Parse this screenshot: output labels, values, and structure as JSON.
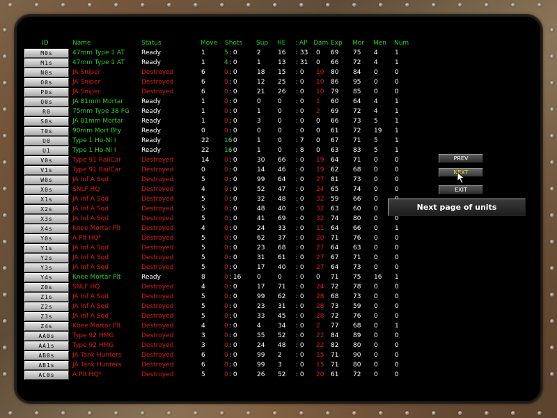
{
  "headers": {
    "id": "ID",
    "name": "Name",
    "status": "Status",
    "move": "Move",
    "shots": "Shots",
    "sup": "Sup",
    "he": "HE",
    "ap": ": AP",
    "dam": "Dam",
    "exp": "Exp",
    "mor": "Mor",
    "men": "Men",
    "num": "Num"
  },
  "units": [
    {
      "id": "M0s",
      "name": "47mm Type 1 AT",
      "status": "Ready",
      "move": "1",
      "shots_a": "5",
      "shots_b": ": 0",
      "sup": "2",
      "he": "16",
      "ap": ": 33",
      "dam": "0",
      "exp": "69",
      "mor": "75",
      "men": "4",
      "num": "1"
    },
    {
      "id": "M1s",
      "name": "47mm Type 1 AT",
      "status": "Ready",
      "move": "1",
      "shots_a": "4",
      "shots_b": ": 0",
      "sup": "1",
      "he": "13",
      "ap": ": 31",
      "dam": "0",
      "exp": "66",
      "mor": "72",
      "men": "4",
      "num": "1"
    },
    {
      "id": "N0s",
      "name": "JA Sniper",
      "status": "Destroyed",
      "move": "6",
      "shots_a": "0",
      "shots_b": ": 0",
      "sup": "18",
      "he": "15",
      "ap": ": 0",
      "dam": "10",
      "exp": "80",
      "mor": "84",
      "men": "0",
      "num": "0"
    },
    {
      "id": "O0s",
      "name": "JA Sniper",
      "status": "Destroyed",
      "move": "6",
      "shots_a": "0",
      "shots_b": ": 0",
      "sup": "12",
      "he": "25",
      "ap": ": 0",
      "dam": "10",
      "exp": "86",
      "mor": "95",
      "men": "0",
      "num": "0"
    },
    {
      "id": "P0s",
      "name": "JA Sniper",
      "status": "Destroyed",
      "move": "6",
      "shots_a": "0",
      "shots_b": ": 0",
      "sup": "21",
      "he": "26",
      "ap": ": 0",
      "dam": "10",
      "exp": "79",
      "mor": "85",
      "men": "0",
      "num": "0"
    },
    {
      "id": "Q0s",
      "name": "JA 81mm Mortar",
      "status": "Ready",
      "move": "1",
      "shots_a": "0",
      "shots_b": ": 0",
      "sup": "0",
      "he": "0",
      "ap": ": 0",
      "dam": "1",
      "exp": "60",
      "mor": "64",
      "men": "4",
      "num": "1"
    },
    {
      "id": "R0",
      "name": "75mm Type 38 FG",
      "status": "Ready",
      "move": "1",
      "shots_a": "0",
      "shots_b": ": 0",
      "sup": "1",
      "he": "0",
      "ap": ": 0",
      "dam": "2",
      "exp": "69",
      "mor": "72",
      "men": "4",
      "num": "1"
    },
    {
      "id": "S0s",
      "name": "JA 81mm Mortar",
      "status": "Ready",
      "move": "1",
      "shots_a": "0",
      "shots_b": ": 0",
      "sup": "3",
      "he": "0",
      "ap": ": 0",
      "dam": "0",
      "exp": "66",
      "mor": "73",
      "men": "5",
      "num": "1"
    },
    {
      "id": "T0s",
      "name": "90mm Mort Bty",
      "status": "Ready",
      "move": "0",
      "shots_a": "0",
      "shots_b": ": 0",
      "sup": "0",
      "he": "0",
      "ap": ": 0",
      "dam": "0",
      "exp": "61",
      "mor": "72",
      "men": "19",
      "num": "1"
    },
    {
      "id": "U0",
      "name": "Type 1 Ho-Ni I",
      "status": "Ready",
      "move": "22",
      "shots_a": "16",
      "shots_b": ": 0",
      "sup": "1",
      "he": "0",
      "ap": ": 7",
      "dam": "0",
      "exp": "67",
      "mor": "71",
      "men": "5",
      "num": "1"
    },
    {
      "id": "U1",
      "name": "Type 1 Ho-Ni I",
      "status": "Ready",
      "move": "22",
      "shots_a": "16",
      "shots_b": ": 0",
      "sup": "1",
      "he": "0",
      "ap": ": 8",
      "dam": "0",
      "exp": "63",
      "mor": "83",
      "men": "5",
      "num": "1"
    },
    {
      "id": "V0s",
      "name": "Type 91 RailCar",
      "status": "Destroyed",
      "move": "14",
      "shots_a": "0",
      "shots_b": ": 0",
      "sup": "30",
      "he": "66",
      "ap": ": 0",
      "dam": "19",
      "exp": "64",
      "mor": "71",
      "men": "0",
      "num": "0"
    },
    {
      "id": "V1s",
      "name": "Type 91 RailCar",
      "status": "Destroyed",
      "move": "0",
      "shots_a": "0",
      "shots_b": ": 0",
      "sup": "14",
      "he": "46",
      "ap": ": 0",
      "dam": "19",
      "exp": "62",
      "mor": "68",
      "men": "0",
      "num": "0"
    },
    {
      "id": "W0s",
      "name": "JA Inf A Sqd",
      "status": "Destroyed",
      "move": "5",
      "shots_a": "0",
      "shots_b": ": 0",
      "sup": "99",
      "he": "64",
      "ap": ": 0",
      "dam": "27",
      "exp": "81",
      "mor": "73",
      "men": "0",
      "num": "0"
    },
    {
      "id": "X0s",
      "name": "SNLF HQ",
      "status": "Destroyed",
      "move": "4",
      "shots_a": "0",
      "shots_b": ": 0",
      "sup": "52",
      "he": "47",
      "ap": ": 0",
      "dam": "24",
      "exp": "65",
      "mor": "74",
      "men": "0",
      "num": "0"
    },
    {
      "id": "X1s",
      "name": "JA Inf A Sqd",
      "status": "Destroyed",
      "move": "5",
      "shots_a": "0",
      "shots_b": ": 0",
      "sup": "32",
      "he": "48",
      "ap": ": 0",
      "dam": "32",
      "exp": "59",
      "mor": "66",
      "men": "0",
      "num": "0"
    },
    {
      "id": "X2s",
      "name": "JA Inf A Sqd",
      "status": "Destroyed",
      "move": "5",
      "shots_a": "0",
      "shots_b": ": 0",
      "sup": "48",
      "he": "40",
      "ap": ": 0",
      "dam": "32",
      "exp": "63",
      "mor": "60",
      "men": "0",
      "num": "0"
    },
    {
      "id": "X3s",
      "name": "JA Inf A Sqd",
      "status": "Destroyed",
      "move": "5",
      "shots_a": "0",
      "shots_b": ": 0",
      "sup": "41",
      "he": "69",
      "ap": ": 0",
      "dam": "32",
      "exp": "74",
      "mor": "80",
      "men": "0",
      "num": "0"
    },
    {
      "id": "X4s",
      "name": "Knee Mortar Plt",
      "status": "Destroyed",
      "move": "4",
      "shots_a": "0",
      "shots_b": ": 0",
      "sup": "24",
      "he": "33",
      "ap": ": 0",
      "dam": "11",
      "exp": "64",
      "mor": "66",
      "men": "0",
      "num": "1"
    },
    {
      "id": "Y0s",
      "name": "A Plt HQ*",
      "status": "Destroyed",
      "move": "5",
      "shots_a": "0",
      "shots_b": ": 0",
      "sup": "62",
      "he": "37",
      "ap": ": 0",
      "dam": "20",
      "exp": "71",
      "mor": "76",
      "men": "0",
      "num": "0"
    },
    {
      "id": "Y1s",
      "name": "JA Inf A Sqd",
      "status": "Destroyed",
      "move": "5",
      "shots_a": "0",
      "shots_b": ": 0",
      "sup": "23",
      "he": "68",
      "ap": ": 0",
      "dam": "27",
      "exp": "64",
      "mor": "63",
      "men": "0",
      "num": "0"
    },
    {
      "id": "Y2s",
      "name": "JA Inf A Sqd",
      "status": "Destroyed",
      "move": "5",
      "shots_a": "0",
      "shots_b": ": 0",
      "sup": "31",
      "he": "61",
      "ap": ": 0",
      "dam": "27",
      "exp": "67",
      "mor": "71",
      "men": "0",
      "num": "0"
    },
    {
      "id": "Y3s",
      "name": "JA Inf A Sqd",
      "status": "Destroyed",
      "move": "5",
      "shots_a": "0",
      "shots_b": ": 0",
      "sup": "17",
      "he": "40",
      "ap": ": 0",
      "dam": "27",
      "exp": "64",
      "mor": "73",
      "men": "0",
      "num": "0"
    },
    {
      "id": "Y4s",
      "name": "Knee Mortar Plt",
      "status": "Ready",
      "move": "8",
      "shots_a": "0",
      "shots_b": ": 16",
      "sup": "0",
      "he": "0",
      "ap": ": 0",
      "dam": "0",
      "exp": "71",
      "mor": "75",
      "men": "16",
      "num": "1"
    },
    {
      "id": "Z0s",
      "name": "SNLF HQ",
      "status": "Destroyed",
      "move": "4",
      "shots_a": "0",
      "shots_b": ": 0",
      "sup": "17",
      "he": "71",
      "ap": ": 0",
      "dam": "24",
      "exp": "72",
      "mor": "78",
      "men": "0",
      "num": "0"
    },
    {
      "id": "Z1s",
      "name": "JA Inf A Sqd",
      "status": "Destroyed",
      "move": "5",
      "shots_a": "0",
      "shots_b": ": 0",
      "sup": "99",
      "he": "62",
      "ap": ": 0",
      "dam": "28",
      "exp": "68",
      "mor": "73",
      "men": "0",
      "num": "0"
    },
    {
      "id": "Z2s",
      "name": "JA Inf A Sqd",
      "status": "Destroyed",
      "move": "5",
      "shots_a": "0",
      "shots_b": ": 0",
      "sup": "23",
      "he": "31",
      "ap": ": 0",
      "dam": "28",
      "exp": "73",
      "mor": "59",
      "men": "0",
      "num": "0"
    },
    {
      "id": "Z3s",
      "name": "JA Inf A Sqd",
      "status": "Destroyed",
      "move": "5",
      "shots_a": "0",
      "shots_b": ": 0",
      "sup": "33",
      "he": "45",
      "ap": ": 0",
      "dam": "28",
      "exp": "72",
      "mor": "76",
      "men": "0",
      "num": "0"
    },
    {
      "id": "Z4s",
      "name": "Knee Mortar Plt",
      "status": "Destroyed",
      "move": "4",
      "shots_a": "0",
      "shots_b": ": 0",
      "sup": "4",
      "he": "34",
      "ap": ": 0",
      "dam": "2",
      "exp": "77",
      "mor": "68",
      "men": "0",
      "num": "1"
    },
    {
      "id": "AA0s",
      "name": "Type 92 HMG",
      "status": "Destroyed",
      "move": "3",
      "shots_a": "0",
      "shots_b": ": 0",
      "sup": "55",
      "he": "52",
      "ap": ": 0",
      "dam": "22",
      "exp": "84",
      "mor": "89",
      "men": "0",
      "num": "0"
    },
    {
      "id": "AA1s",
      "name": "Type 92 HMG",
      "status": "Destroyed",
      "move": "3",
      "shots_a": "0",
      "shots_b": ": 0",
      "sup": "24",
      "he": "48",
      "ap": ": 0",
      "dam": "22",
      "exp": "82",
      "mor": "80",
      "men": "0",
      "num": "0"
    },
    {
      "id": "AB0s",
      "name": "JA Tank Hunters",
      "status": "Destroyed",
      "move": "6",
      "shots_a": "0",
      "shots_b": ": 0",
      "sup": "99",
      "he": "2",
      "ap": ": 0",
      "dam": "15",
      "exp": "71",
      "mor": "90",
      "men": "0",
      "num": "0"
    },
    {
      "id": "AB1s",
      "name": "JA Tank Hunters",
      "status": "Destroyed",
      "move": "6",
      "shots_a": "0",
      "shots_b": ": 0",
      "sup": "99",
      "he": "3",
      "ap": ": 0",
      "dam": "15",
      "exp": "71",
      "mor": "80",
      "men": "0",
      "num": "0"
    },
    {
      "id": "AC0s",
      "name": "A Plt HQ*",
      "status": "Destroyed",
      "move": "5",
      "shots_a": "0",
      "shots_b": ": 0",
      "sup": "26",
      "he": "52",
      "ap": ": 0",
      "dam": "20",
      "exp": "61",
      "mor": "72",
      "men": "0",
      "num": "0"
    }
  ],
  "buttons": {
    "prev": "PREV",
    "next": "NEXT",
    "exit": "EXIT"
  },
  "tooltip": "Next page of units",
  "colors": {
    "green": "#22d222",
    "red": "#e01818",
    "white": "#ffffff",
    "yellow": "#f0e020"
  }
}
